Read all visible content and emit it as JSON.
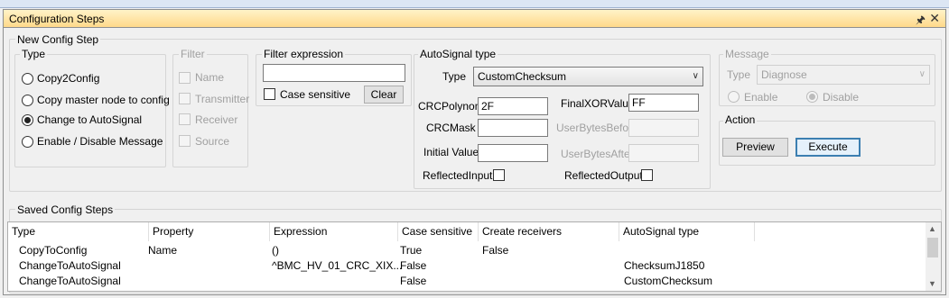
{
  "window": {
    "title": "Configuration Steps"
  },
  "new_step": {
    "label": "New Config Step",
    "type": {
      "label": "Type",
      "options": [
        "Copy2Config",
        "Copy master node to config",
        "Change to AutoSignal",
        "Enable / Disable Message"
      ],
      "selected": "Change to AutoSignal"
    },
    "filter": {
      "label": "Filter",
      "options": [
        "Name",
        "Transmitter",
        "Receiver",
        "Source"
      ]
    },
    "filter_expression": {
      "label": "Filter expression",
      "value": "",
      "case_sensitive_label": "Case sensitive",
      "clear_label": "Clear"
    },
    "autosignal": {
      "label": "AutoSignal type",
      "type_label": "Type",
      "type_value": "CustomChecksum",
      "crc_polynom_label": "CRCPolynom",
      "crc_polynom_value": "2F",
      "final_xor_label": "FinalXORValue",
      "final_xor_value": "FF",
      "crc_mask_label": "CRCMask",
      "crc_mask_value": "",
      "user_bytes_before_label": "UserBytesBefore",
      "initial_value_label": "Initial Value",
      "initial_value_value": "",
      "user_bytes_after_label": "UserBytesAfter",
      "reflected_input_label": "ReflectedInput",
      "reflected_output_label": "ReflectedOutput"
    },
    "message": {
      "label": "Message",
      "type_label": "Type",
      "type_value": "Diagnose",
      "enable_label": "Enable",
      "disable_label": "Disable",
      "selected": "Disable"
    },
    "action": {
      "label": "Action",
      "preview_label": "Preview",
      "execute_label": "Execute"
    }
  },
  "saved": {
    "label": "Saved Config Steps",
    "columns": [
      "Type",
      "Property",
      "Expression",
      "Case sensitive",
      "Create receivers",
      "AutoSignal type"
    ],
    "rows": [
      [
        "CopyToConfig",
        "Name",
        "()",
        "True",
        "False",
        ""
      ],
      [
        "ChangeToAutoSignal",
        "",
        "^BMC_HV_01_CRC_XIX...",
        "False",
        "",
        "ChecksumJ1850"
      ],
      [
        "ChangeToAutoSignal",
        "",
        "",
        "False",
        "",
        "CustomChecksum"
      ]
    ]
  },
  "icons": {
    "pin": "pin-icon",
    "close": "close-icon",
    "dropdown": "chevron-down-icon"
  }
}
